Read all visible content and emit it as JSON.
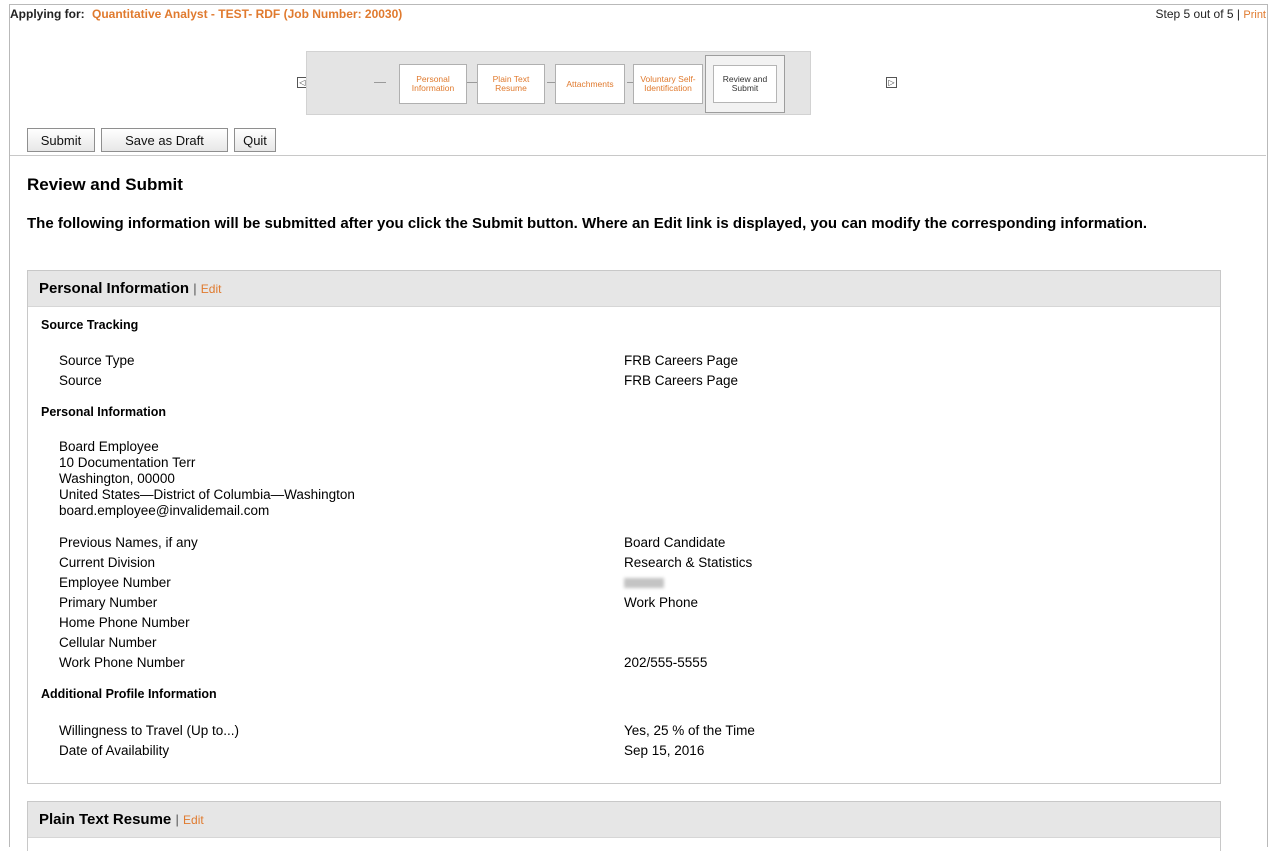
{
  "header": {
    "applying_label": "Applying for:",
    "job_title": "Quantitative Analyst - TEST- RDF (Job Number: 20030)",
    "step_text": "Step 5 out of 5 |",
    "print_label": "Print"
  },
  "wizard": {
    "steps": [
      {
        "label": "Personal Information"
      },
      {
        "label": "Plain Text Resume"
      },
      {
        "label": "Attachments"
      },
      {
        "label": "Voluntary Self-Identification"
      },
      {
        "label": "Review and Submit"
      }
    ],
    "prev_icon": "◁",
    "next_icon": "▷"
  },
  "toolbar": {
    "submit_label": "Submit",
    "save_label": "Save as Draft",
    "quit_label": "Quit"
  },
  "page": {
    "title": "Review and Submit",
    "intro": "The following information will be submitted after you click the Submit button. Where an Edit link is displayed, you can modify the corresponding information."
  },
  "personal_section": {
    "title": "Personal Information",
    "separator": "|",
    "edit_label": "Edit",
    "source_tracking": {
      "heading": "Source Tracking",
      "rows": [
        {
          "label": "Source Type",
          "value": "FRB Careers Page"
        },
        {
          "label": "Source",
          "value": "FRB Careers Page"
        }
      ]
    },
    "personal_info": {
      "heading": "Personal Information",
      "address_lines": [
        "Board Employee",
        "10 Documentation Terr",
        "Washington, 00000",
        "United States—District of Columbia—Washington",
        "board.employee@invalidemail.com"
      ],
      "rows": [
        {
          "label": "Previous Names, if any",
          "value": "Board Candidate"
        },
        {
          "label": "Current Division",
          "value": "Research & Statistics"
        },
        {
          "label": "Employee Number",
          "value": ""
        },
        {
          "label": "Primary Number",
          "value": "Work Phone"
        },
        {
          "label": "Home Phone Number",
          "value": ""
        },
        {
          "label": "Cellular Number",
          "value": ""
        },
        {
          "label": "Work Phone Number",
          "value": "202/555-5555"
        }
      ]
    },
    "additional": {
      "heading": "Additional Profile Information",
      "rows": [
        {
          "label": "Willingness to Travel (Up to...)",
          "value": "Yes, 25 % of the Time"
        },
        {
          "label": "Date of Availability",
          "value": "Sep 15, 2016"
        }
      ]
    }
  },
  "resume_section": {
    "title": "Plain Text Resume",
    "separator": "|",
    "edit_label": "Edit"
  },
  "colors": {
    "accent": "#e07a2e",
    "section_header_bg": "#e6e6e6"
  }
}
